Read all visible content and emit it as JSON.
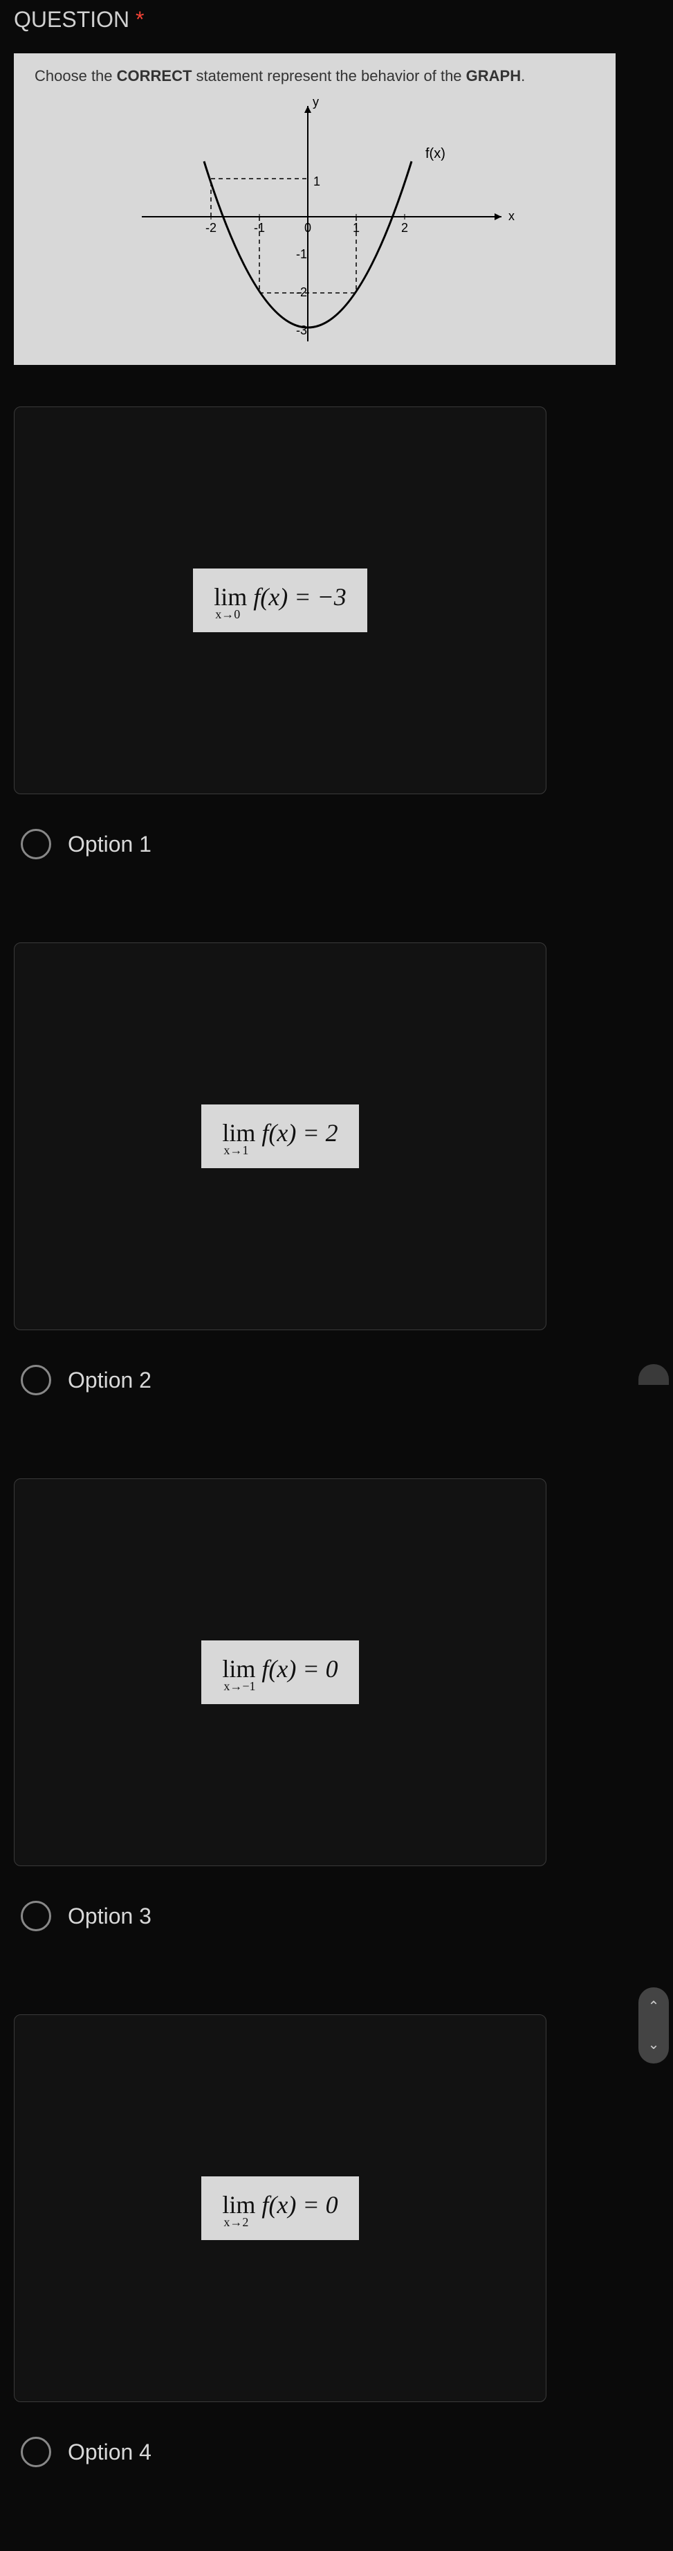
{
  "header": {
    "label": "QUESTION",
    "required_mark": "*"
  },
  "graph": {
    "instruction_prefix": "Choose the ",
    "instruction_bold1": "CORRECT",
    "instruction_mid": " statement represent the behavior of the ",
    "instruction_bold2": "GRAPH",
    "instruction_suffix": ".",
    "y_label": "y",
    "x_label": "x",
    "fx_label": "f(x)",
    "ticks_x": [
      "-2",
      "-1",
      "0",
      "1",
      "2"
    ],
    "ticks_y_neg": [
      "-1",
      "-2",
      "-3"
    ]
  },
  "options": [
    {
      "lim": "lim",
      "sub": "x→0",
      "expr": "f(x) = −3",
      "label": "Option 1"
    },
    {
      "lim": "lim",
      "sub": "x→1",
      "expr": "f(x) = 2",
      "label": "Option 2"
    },
    {
      "lim": "lim",
      "sub": "x→−1",
      "expr": "f(x) = 0",
      "label": "Option 3"
    },
    {
      "lim": "lim",
      "sub": "x→2",
      "expr": "f(x) = 0",
      "label": "Option 4"
    }
  ],
  "nav": {
    "up": "⌃",
    "down": "⌄"
  },
  "chart_data": {
    "type": "line",
    "title": "",
    "xlabel": "x",
    "ylabel": "y",
    "series": [
      {
        "name": "f(x)",
        "x": [
          -2,
          -1,
          0,
          1,
          2
        ],
        "y": [
          1,
          -2,
          -3,
          -2,
          1
        ]
      }
    ],
    "annotations": [
      "f(x)"
    ],
    "xlim": [
      -2.5,
      3
    ],
    "ylim": [
      -3.2,
      1.5
    ],
    "dashed_guides": [
      {
        "from": [
          -1,
          0
        ],
        "to": [
          -1,
          -2
        ]
      },
      {
        "from": [
          1,
          0
        ],
        "to": [
          1,
          -2
        ]
      },
      {
        "from": [
          -1,
          -2
        ],
        "to": [
          1,
          -2
        ]
      },
      {
        "from": [
          -2,
          0
        ],
        "to": [
          -2,
          1
        ]
      },
      {
        "from": [
          -2,
          1
        ],
        "to": [
          0,
          1
        ]
      }
    ]
  }
}
